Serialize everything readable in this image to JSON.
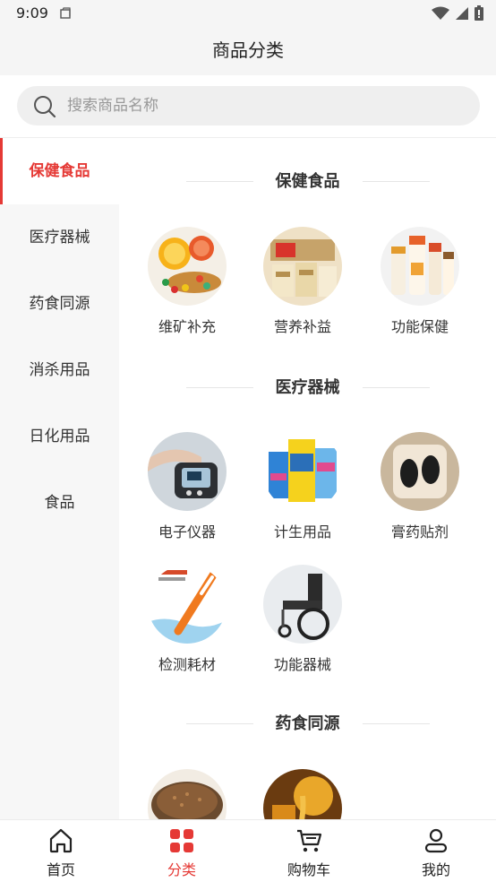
{
  "status_bar": {
    "time": "9:09"
  },
  "header": {
    "title": "商品分类"
  },
  "search": {
    "placeholder": "搜索商品名称"
  },
  "sidebar": {
    "active_index": 0,
    "items": [
      {
        "label": "保健食品"
      },
      {
        "label": "医疗器械"
      },
      {
        "label": "药食同源"
      },
      {
        "label": "消杀用品"
      },
      {
        "label": "日化用品"
      },
      {
        "label": "食品"
      }
    ]
  },
  "sections": [
    {
      "title": "保健食品",
      "items": [
        {
          "label": "维矿补充",
          "icon": "vitamin-supplement-image"
        },
        {
          "label": "营养补益",
          "icon": "nutrition-boxes-image"
        },
        {
          "label": "功能保健",
          "icon": "health-bottles-image"
        }
      ]
    },
    {
      "title": "医疗器械",
      "items": [
        {
          "label": "电子仪器",
          "icon": "blood-pressure-monitor-image"
        },
        {
          "label": "计生用品",
          "icon": "family-planning-boxes-image"
        },
        {
          "label": "膏药贴剂",
          "icon": "medical-patch-image"
        },
        {
          "label": "检测耗材",
          "icon": "thermometer-image"
        },
        {
          "label": "功能器械",
          "icon": "wheelchair-image"
        }
      ]
    },
    {
      "title": "药食同源",
      "items": [
        {
          "label": "",
          "icon": "grain-bowl-image"
        },
        {
          "label": "",
          "icon": "honey-jar-image"
        }
      ]
    }
  ],
  "tab_bar": {
    "active_index": 1,
    "tabs": [
      {
        "label": "首页",
        "icon": "home-icon"
      },
      {
        "label": "分类",
        "icon": "category-grid-icon"
      },
      {
        "label": "购物车",
        "icon": "cart-icon"
      },
      {
        "label": "我的",
        "icon": "profile-icon"
      }
    ]
  },
  "colors": {
    "accent": "#e53935",
    "sidebar_bg": "#f7f7f7",
    "search_bg": "#efefef"
  }
}
